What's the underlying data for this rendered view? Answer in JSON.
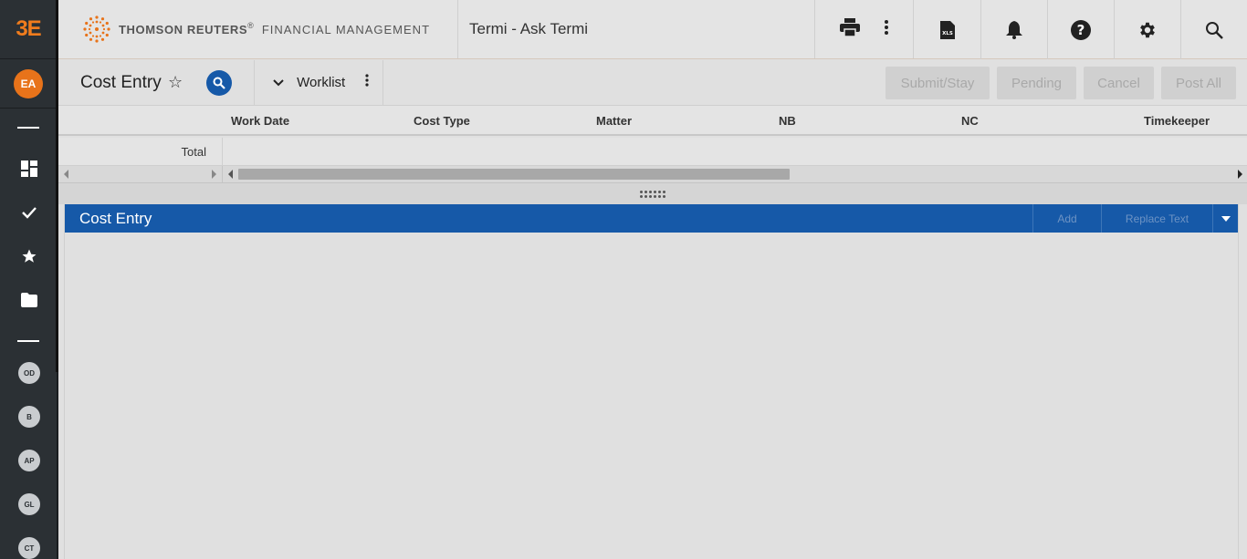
{
  "rail": {
    "logo": "3E",
    "user_initials": "EA",
    "shortcuts": [
      "OD",
      "B",
      "AP",
      "GL",
      "CT"
    ]
  },
  "topbar": {
    "brand_primary": "THOMSON REUTERS",
    "brand_reg": "®",
    "brand_secondary": "FINANCIAL MANAGEMENT",
    "app_title": "Termi - Ask Termi"
  },
  "page": {
    "title": "Cost Entry",
    "worklist_label": "Worklist",
    "actions": {
      "submit_stay": "Submit/Stay",
      "pending": "Pending",
      "cancel": "Cancel",
      "post_all": "Post All"
    }
  },
  "grid": {
    "columns": [
      "Work Date",
      "Cost Type",
      "Matter",
      "NB",
      "NC",
      "Timekeeper"
    ],
    "total_label": "Total"
  },
  "panel": {
    "title": "Cost Entry",
    "add_label": "Add",
    "replace_label": "Replace Text"
  },
  "colors": {
    "brand_orange": "#e8731a",
    "primary_blue": "#1659a8",
    "rail_bg": "#2b3034"
  }
}
